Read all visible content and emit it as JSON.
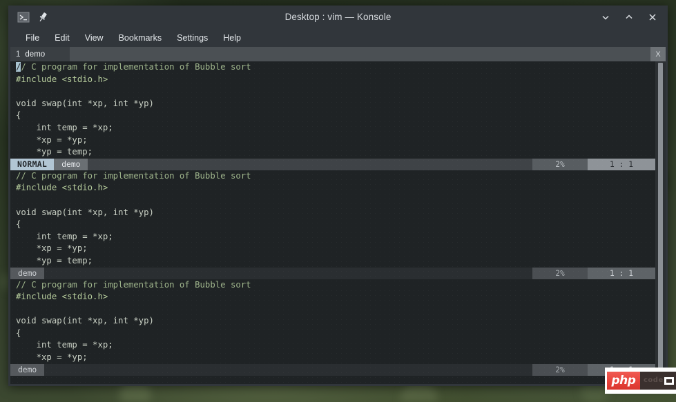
{
  "window": {
    "title": "Desktop : vim — Konsole",
    "app_icon": "konsole-icon",
    "pin_icon": "pin-icon",
    "minimize_label": "⌄",
    "maximize_label": "⌃",
    "close_label": "✕"
  },
  "menubar": {
    "items": [
      {
        "label": "File"
      },
      {
        "label": "Edit"
      },
      {
        "label": "View"
      },
      {
        "label": "Bookmarks"
      },
      {
        "label": "Settings"
      },
      {
        "label": "Help"
      }
    ]
  },
  "tabbar": {
    "tabs": [
      {
        "index": "1",
        "label": "demo"
      }
    ],
    "close_label": "X"
  },
  "panes": [
    {
      "id": "pane-top",
      "active": true,
      "lines": [
        {
          "text": "// C program for implementation of Bubble sort",
          "kind": "comment",
          "cursor_at": 0
        },
        {
          "text": "#include <stdio.h>",
          "kind": "pre"
        },
        {
          "text": "",
          "kind": "text"
        },
        {
          "text": "void swap(int *xp, int *yp)",
          "kind": "text"
        },
        {
          "text": "{",
          "kind": "text"
        },
        {
          "text": "    int temp = *xp;",
          "kind": "text"
        },
        {
          "text": "    *xp = *yp;",
          "kind": "text"
        },
        {
          "text": "    *yp = temp;",
          "kind": "text"
        }
      ],
      "status": {
        "mode": "NORMAL",
        "file": "demo",
        "percent": "2%",
        "position": "1 : 1"
      }
    },
    {
      "id": "pane-middle",
      "active": false,
      "lines": [
        {
          "text": "// C program for implementation of Bubble sort",
          "kind": "comment"
        },
        {
          "text": "#include <stdio.h>",
          "kind": "pre"
        },
        {
          "text": "",
          "kind": "text"
        },
        {
          "text": "void swap(int *xp, int *yp)",
          "kind": "text"
        },
        {
          "text": "{",
          "kind": "text"
        },
        {
          "text": "    int temp = *xp;",
          "kind": "text"
        },
        {
          "text": "    *xp = *yp;",
          "kind": "text"
        },
        {
          "text": "    *yp = temp;",
          "kind": "text"
        }
      ],
      "status": {
        "mode": "",
        "file": "demo",
        "percent": "2%",
        "position": "1 : 1"
      }
    },
    {
      "id": "pane-bottom",
      "active": false,
      "lines": [
        {
          "text": "// C program for implementation of Bubble sort",
          "kind": "comment"
        },
        {
          "text": "#include <stdio.h>",
          "kind": "pre"
        },
        {
          "text": "",
          "kind": "text"
        },
        {
          "text": "void swap(int *xp, int *yp)",
          "kind": "text"
        },
        {
          "text": "{",
          "kind": "text"
        },
        {
          "text": "    int temp = *xp;",
          "kind": "text"
        },
        {
          "text": "    *xp = *yp;",
          "kind": "text"
        }
      ],
      "status": {
        "mode": "",
        "file": "demo",
        "percent": "2%",
        "position": "1 : 1"
      }
    }
  ],
  "php_badge": {
    "logo_text": "php",
    "ghost_text": "code",
    "monitor_icon": "monitor-icon"
  },
  "colors": {
    "titlebar_bg": "#31363b",
    "terminal_bg": "#1f2325",
    "accent_mode": "#b2c6d4",
    "php_red": "#e8443c",
    "comment_green": "#9fb58c"
  }
}
